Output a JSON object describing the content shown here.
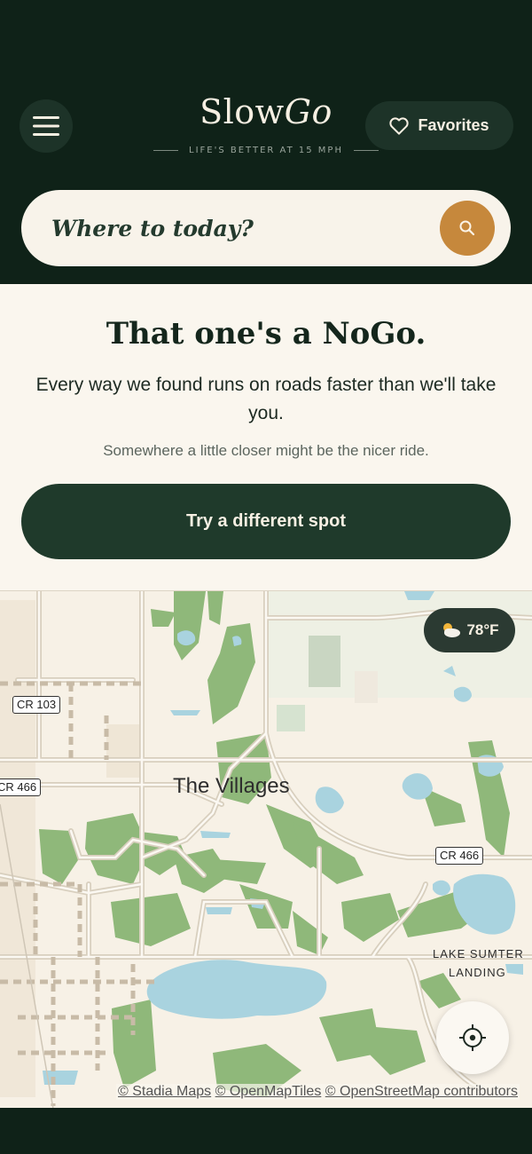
{
  "header": {
    "logo_slow": "Slow",
    "logo_go": "Go",
    "tagline": "LIFE'S BETTER AT 15 MPH",
    "favorites_label": "Favorites",
    "menu_icon": "hamburger-menu-icon",
    "favorites_icon": "heart-icon"
  },
  "search": {
    "placeholder": "Where to today?",
    "icon": "search-icon",
    "button_color": "#c6883c"
  },
  "message": {
    "title": "That one's a NoGo.",
    "description": "Every way we found runs on roads faster than we'll take you.",
    "hint": "Somewhere a little closer might be the nicer ride.",
    "cta_label": "Try a different spot"
  },
  "map": {
    "weather": {
      "icon": "sun-behind-cloud-icon",
      "temp": "78°F"
    },
    "road_labels": [
      "CR 103",
      "CR 466",
      "CR 466"
    ],
    "place_labels": [
      "The Villages",
      "LAKE SUMTER",
      "LANDING"
    ],
    "locate_icon": "crosshair-icon",
    "attribution": [
      "© Stadia Maps",
      "© OpenMapTiles",
      "© OpenStreetMap contributors"
    ],
    "colors": {
      "land": "#f7f1e6",
      "water": "#a9d3df",
      "park": "#8fb87a",
      "road": "#d8cfbe"
    }
  }
}
